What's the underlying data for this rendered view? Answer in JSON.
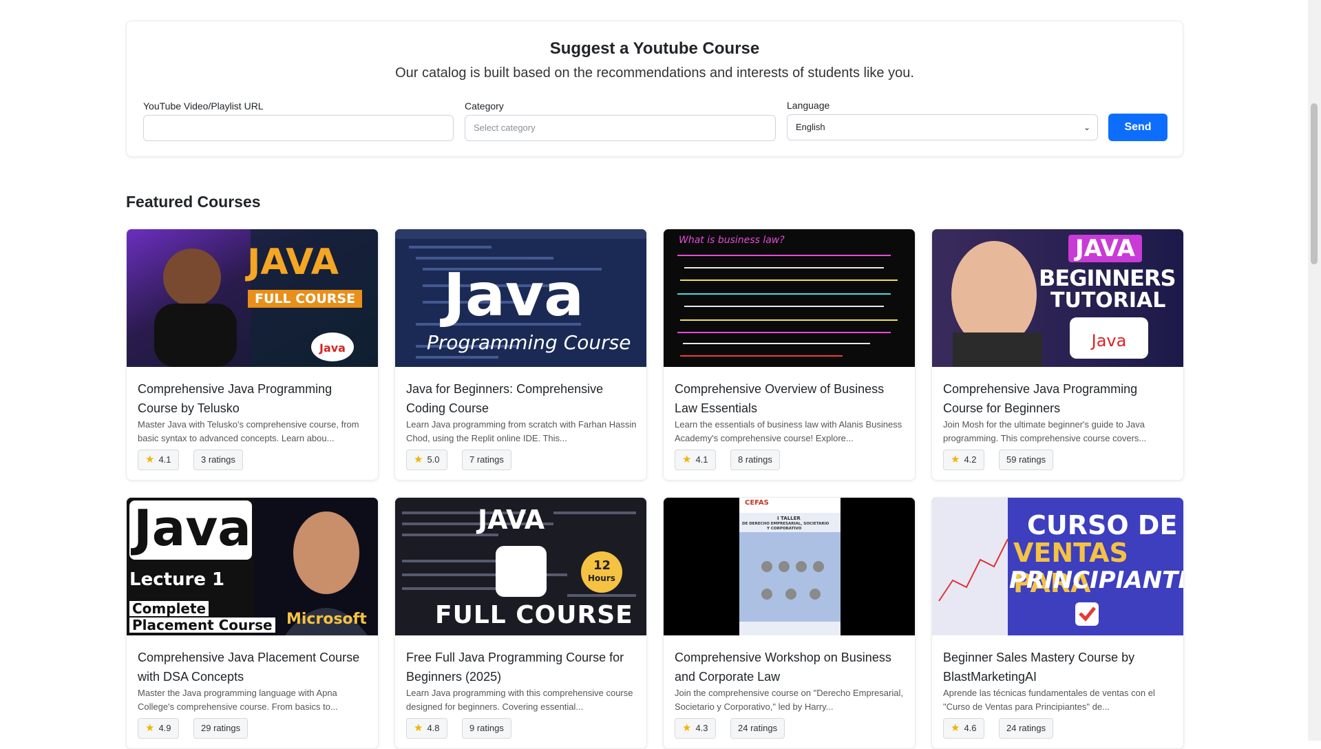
{
  "suggest": {
    "title": "Suggest a Youtube Course",
    "subtitle": "Our catalog is built based on the recommendations and interests of students like you.",
    "url_label": "YouTube Video/Playlist URL",
    "url_value": "",
    "category_label": "Category",
    "category_placeholder": "Select category",
    "language_label": "Language",
    "language_value": "English",
    "send_label": "Send"
  },
  "featured_title": "Featured Courses",
  "courses": [
    {
      "title": "Comprehensive Java Programming Course by Telusko",
      "desc": "Master Java with Telusko's comprehensive course, from basic syntax to advanced concepts. Learn abou...",
      "rating": "4.1",
      "ratings": "3 ratings",
      "thumb_text": [
        "JAVA",
        "FULL COURSE",
        "Java"
      ]
    },
    {
      "title": "Java for Beginners: Comprehensive Coding Course",
      "desc": "Learn Java programming from scratch with Farhan Hassin Chod, using the Replit online IDE. This...",
      "rating": "5.0",
      "ratings": "7 ratings",
      "thumb_text": [
        "Java",
        "Programming Course"
      ]
    },
    {
      "title": "Comprehensive Overview of Business Law Essentials",
      "desc": "Learn the essentials of business law with Alanis Business Academy's comprehensive course! Explore...",
      "rating": "4.1",
      "ratings": "8 ratings",
      "thumb_text": [
        "What is business law?"
      ]
    },
    {
      "title": "Comprehensive Java Programming Course for Beginners",
      "desc": "Join Mosh for the ultimate beginner's guide to Java programming. This comprehensive course covers...",
      "rating": "4.2",
      "ratings": "59 ratings",
      "thumb_text": [
        "JAVA",
        "BEGINNERS",
        "TUTORIAL",
        "Java"
      ]
    },
    {
      "title": "Comprehensive Java Placement Course with DSA Concepts",
      "desc": "Master the Java programming language with Apna College's comprehensive course. From basics to...",
      "rating": "4.9",
      "ratings": "29 ratings",
      "thumb_text": [
        "Java",
        "Lecture 1",
        "Complete",
        "Placement Course",
        "Microsoft"
      ]
    },
    {
      "title": "Free Full Java Programming Course for Beginners (2025)",
      "desc": "Learn Java programming with this comprehensive course designed for beginners. Covering essential...",
      "rating": "4.8",
      "ratings": "9 ratings",
      "thumb_text": [
        "JAVA",
        "FULL COURSE",
        "12",
        "Hours"
      ]
    },
    {
      "title": "Comprehensive Workshop on Business and Corporate Law",
      "desc": "Join the comprehensive course on \"Derecho Empresarial, Societario y Corporativo,\" led by Harry...",
      "rating": "4.3",
      "ratings": "24 ratings",
      "thumb_text": [
        "CEFAS",
        "I TALLER",
        "DE DERECHO EMPRESARIAL, SOCIETARIO",
        "Y CORPORATIVO"
      ]
    },
    {
      "title": "Beginner Sales Mastery Course by BlastMarketingAI",
      "desc": "Aprende las técnicas fundamentales de ventas con el \"Curso de Ventas para Principiantes\" de...",
      "rating": "4.6",
      "ratings": "24 ratings",
      "thumb_text": [
        "CURSO DE",
        "VENTAS PARA",
        "PRINCIPIANTES"
      ]
    }
  ],
  "colors": {
    "primary": "#0d6efd",
    "star": "#f0b400"
  },
  "icons": {
    "star": "star-icon",
    "select_arrow": "chevron-down-icon"
  }
}
